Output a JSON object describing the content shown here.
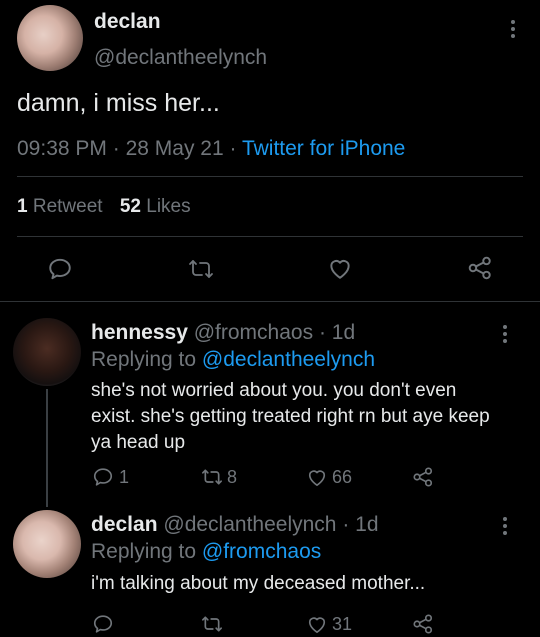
{
  "tweet": {
    "display_name": "declan",
    "handle": "@declantheelynch",
    "text": "damn, i miss her...",
    "time": "09:38 PM",
    "date": "28 May 21",
    "dot1": "·",
    "dot2": "·",
    "source": "Twitter for iPhone",
    "retweets_count": "1",
    "retweets_label": "Retweet",
    "likes_count": "52",
    "likes_label": "Likes"
  },
  "replies": [
    {
      "display_name": "hennessy",
      "handle": "@fromchaos",
      "sep": "·",
      "age": "1d",
      "replying_label": "Replying to",
      "replying_handle": "@declantheelynch",
      "text": "she's not worried about you. you don't even exist. she's getting treated right rn but aye keep ya head up",
      "reply_count": "1",
      "retweet_count": "8",
      "like_count": "66"
    },
    {
      "display_name": "declan",
      "handle": "@declantheelynch",
      "sep": "·",
      "age": "1d",
      "replying_label": "Replying to",
      "replying_handle": "@fromchaos",
      "text": "i'm talking about my deceased mother...",
      "reply_count": "",
      "retweet_count": "",
      "like_count": "31"
    }
  ],
  "colors": {
    "background": "#000000",
    "text": "#e7e9ea",
    "muted": "#71767b",
    "accent": "#1d9bf0",
    "divider": "#2f3336"
  }
}
